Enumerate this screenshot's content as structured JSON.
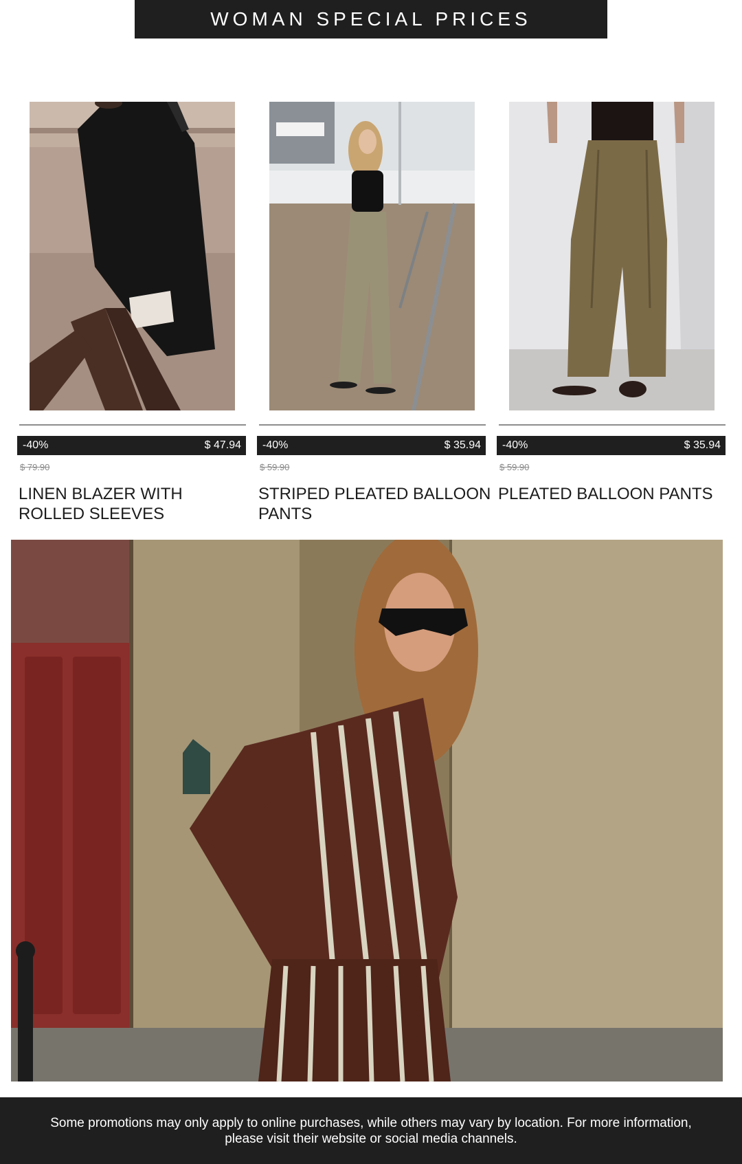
{
  "banner": {
    "title": "WOMAN SPECIAL PRICES"
  },
  "products": [
    {
      "discount": "-40%",
      "price": "$ 47.94",
      "old_price": "$ 79.90",
      "name": "LINEN BLAZER WITH ROLLED SLEEVES"
    },
    {
      "discount": "-40%",
      "price": "$ 35.94",
      "old_price": "$ 59.90",
      "name": "STRIPED PLEATED BALLOON PANTS"
    },
    {
      "discount": "-40%",
      "price": "$ 35.94",
      "old_price": "$ 59.90",
      "name": "PLEATED BALLOON PANTS"
    }
  ],
  "footer": {
    "note": "Some promotions may only apply to online purchases, while others may vary by location. For more information, please visit their website or social media channels."
  }
}
